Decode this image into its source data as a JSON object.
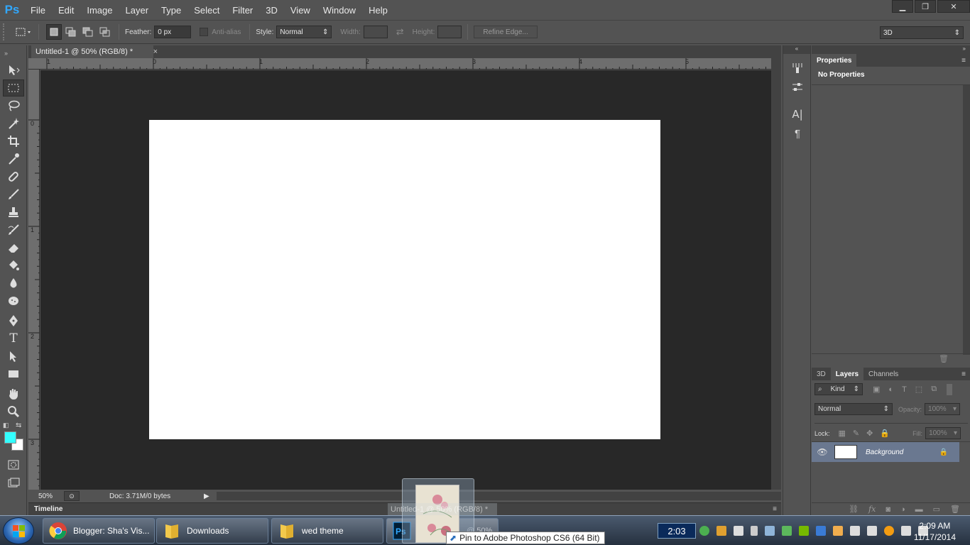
{
  "app": {
    "logo": "Ps"
  },
  "menu": [
    "File",
    "Edit",
    "Image",
    "Layer",
    "Type",
    "Select",
    "Filter",
    "3D",
    "View",
    "Window",
    "Help"
  ],
  "window_controls": {
    "minimize": "▁",
    "restore": "❐",
    "close": "✕"
  },
  "options_bar": {
    "feather_label": "Feather:",
    "feather_value": "0 px",
    "antialias_label": "Anti-alias",
    "style_label": "Style:",
    "style_value": "Normal",
    "width_label": "Width:",
    "height_label": "Height:",
    "refine_edge_label": "Refine Edge...",
    "workspace_value": "3D"
  },
  "document": {
    "tab_title": "Untitled-1 @ 50% (RGB/8) *",
    "tab_close": "×",
    "ruler_top_labels": [
      "1",
      "0",
      "1",
      "2",
      "3",
      "4",
      "5"
    ],
    "ruler_left_labels": [
      "0",
      "1",
      "2",
      "3"
    ],
    "zoom": "50%",
    "doc_info": "Doc: 3.71M/0 bytes",
    "canvas_color": "#ffffff"
  },
  "timeline_label": "Timeline",
  "properties_panel": {
    "tab": "Properties",
    "content": "No Properties"
  },
  "layers_panel": {
    "tabs": [
      "3D",
      "Layers",
      "Channels"
    ],
    "active_tab": "Layers",
    "kind_label": "Kind",
    "blend_mode": "Normal",
    "opacity_label": "Opacity:",
    "opacity_value": "100%",
    "lock_label": "Lock:",
    "fill_label": "Fill:",
    "fill_value": "100%",
    "layers": [
      {
        "name": "Background",
        "visible": true,
        "locked": true
      }
    ]
  },
  "colors": {
    "foreground": "#33ffff",
    "background": "#ffffff",
    "accent": "#31a8ff",
    "selected_layer": "#6a7890"
  },
  "taskbar": {
    "tasks": [
      {
        "label": "Blogger: Sha's Vis...",
        "icon": "chrome-icon"
      },
      {
        "label": "Downloads",
        "icon": "folder-icon"
      },
      {
        "label": "wed theme",
        "icon": "folder-icon"
      },
      {
        "label": "",
        "icon": "photoshop-icon"
      }
    ],
    "ghost_label": "Untitled-1 @ 50% (RGB/8) *",
    "ghost_zoom": "@ 50%",
    "tooltip": "Pin to Adobe Photoshop CS6 (64 Bit)",
    "timer": "2:03",
    "clock_time": "2:09 AM",
    "clock_date": "11/17/2014"
  }
}
